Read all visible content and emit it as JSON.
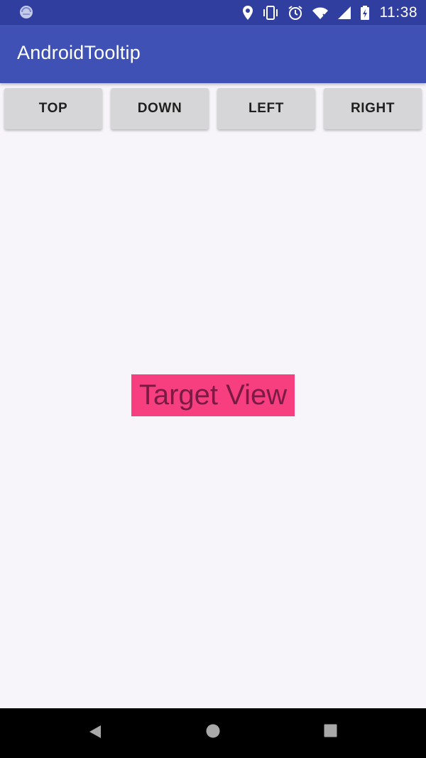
{
  "status_bar": {
    "time": "11:38",
    "icons": [
      "app-notification-icon",
      "location-icon",
      "vibrate-icon",
      "alarm-icon",
      "wifi-icon",
      "signal-icon",
      "battery-charging-icon"
    ]
  },
  "app_bar": {
    "title": "AndroidTooltip",
    "color": "#3f51b5"
  },
  "buttons": {
    "top": "TOP",
    "down": "DOWN",
    "left": "LEFT",
    "right": "RIGHT"
  },
  "target_view": {
    "label": "Target View",
    "color": "#f73f7f"
  },
  "nav_bar": {
    "icons": [
      "back-icon",
      "home-icon",
      "recents-icon"
    ]
  }
}
